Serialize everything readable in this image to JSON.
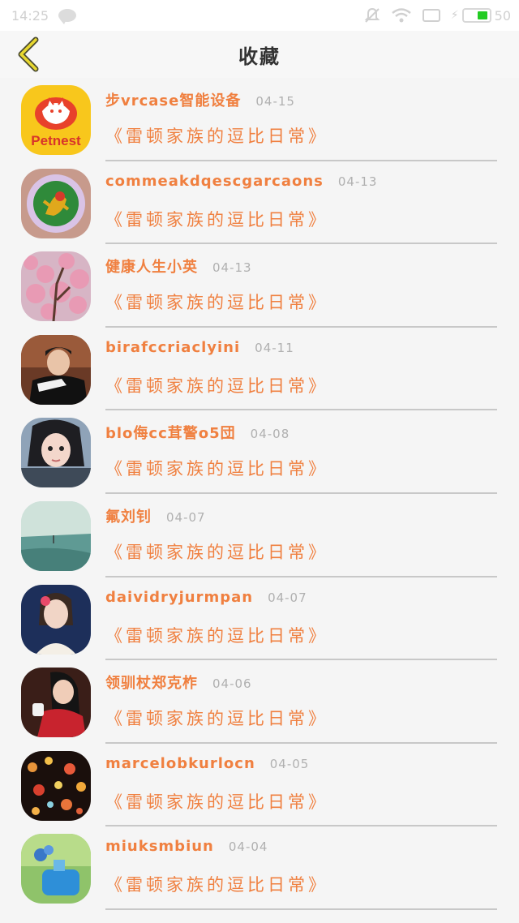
{
  "status_bar": {
    "time": "14:25",
    "battery_percent": "50",
    "colors": {
      "battery": "#22cc22",
      "icons": "#d0d0d0"
    }
  },
  "header": {
    "title": "收藏",
    "back_icon": "chevron-left-icon",
    "colors": {
      "back_icon": "#e8d830"
    }
  },
  "colors": {
    "accent_text": "#f08040",
    "date_text": "#b0b0b0"
  },
  "favorites": [
    {
      "name": "步vrcase智能设备",
      "date": "04-15",
      "subtitle": "《雷顿家族的逗比日常》",
      "avatar": "petnest-logo",
      "avatar_text": "Petnest"
    },
    {
      "name": "commeakdqescgarcaons",
      "date": "04-13",
      "subtitle": "《雷顿家族的逗比日常》",
      "avatar": "monkey-emblem"
    },
    {
      "name": "健康人生小英",
      "date": "04-13",
      "subtitle": "《雷顿家族的逗比日常》",
      "avatar": "pink-blossoms"
    },
    {
      "name": "birafccriaclyini",
      "date": "04-11",
      "subtitle": "《雷顿家族的逗比日常》",
      "avatar": "young-man-photo"
    },
    {
      "name": "blo侮cc茸警o5団",
      "date": "04-08",
      "subtitle": "《雷顿家族的逗比日常》",
      "avatar": "girl-portrait"
    },
    {
      "name": "氟刘钊",
      "date": "04-07",
      "subtitle": "《雷顿家族的逗比日常》",
      "avatar": "seaside-landscape"
    },
    {
      "name": "daividryjurmpan",
      "date": "04-07",
      "subtitle": "《雷顿家族的逗比日常》",
      "avatar": "woman-with-flower"
    },
    {
      "name": "领驯杖郑克柞",
      "date": "04-06",
      "subtitle": "《雷顿家族的逗比日常》",
      "avatar": "girl-red-sweater"
    },
    {
      "name": "marcelobkurlocn",
      "date": "04-05",
      "subtitle": "《雷顿家族的逗比日常》",
      "avatar": "bokeh-hearts"
    },
    {
      "name": "miuksmbiun",
      "date": "04-04",
      "subtitle": "《雷顿家族的逗比日常》",
      "avatar": "blue-bottle"
    }
  ]
}
